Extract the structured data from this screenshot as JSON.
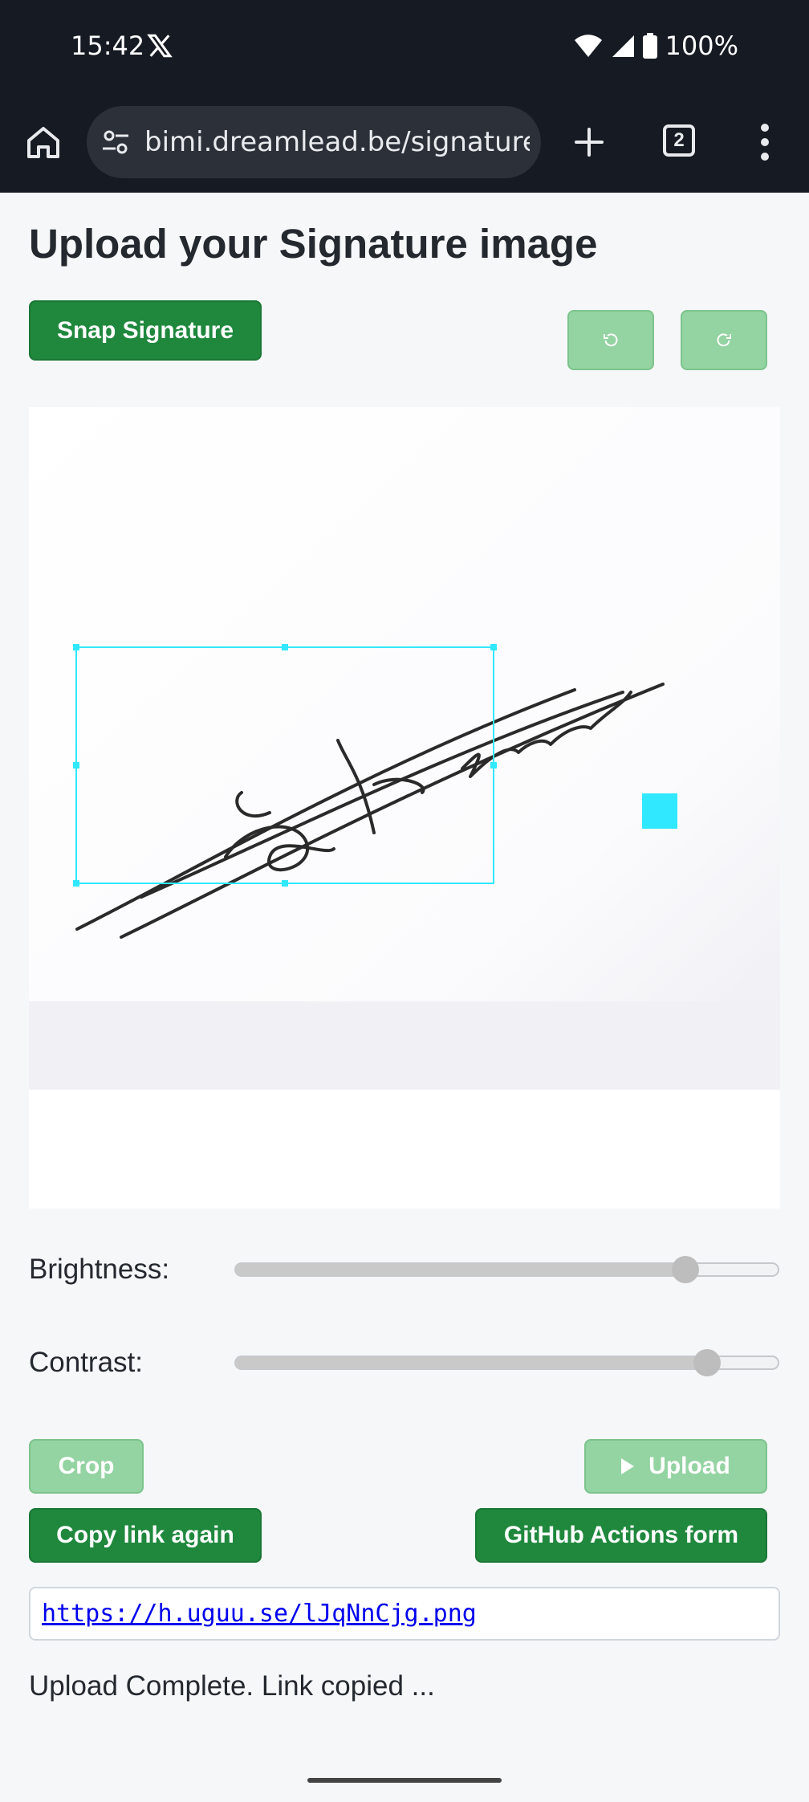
{
  "status_bar": {
    "time": "15:42",
    "battery": "100%"
  },
  "browser": {
    "url": "bimi.dreamlead.be/signature-",
    "tab_count": "2"
  },
  "page": {
    "title": "Upload your Signature image",
    "snap_label": "Snap Signature",
    "brightness_label": "Brightness:",
    "brightness_value": 0.83,
    "contrast_label": "Contrast:",
    "contrast_value": 0.87,
    "crop_label": "Crop",
    "upload_label": "Upload",
    "copy_label": "Copy link again",
    "gha_label": "GitHub Actions form",
    "link": "https://h.uguu.se/lJqNnCjg.png",
    "status": "Upload Complete. Link copied ..."
  },
  "colors": {
    "accent": "#1f883d",
    "disabled": "#94d3a2",
    "crop_box": "#30e8ff"
  }
}
